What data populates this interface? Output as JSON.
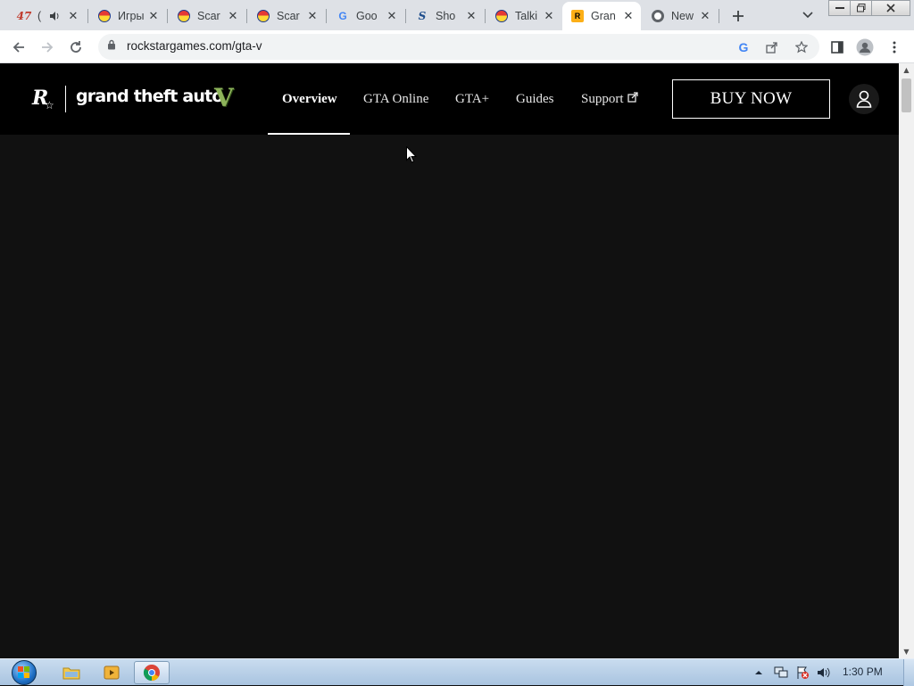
{
  "browser": {
    "tabs": [
      {
        "title": "(",
        "icon": "number-47-icon",
        "has_audio": true,
        "active": false
      },
      {
        "title": "Игры",
        "icon": "multicolor-ball-icon",
        "active": false
      },
      {
        "title": "Scar",
        "icon": "multicolor-ball-icon",
        "active": false
      },
      {
        "title": "Scar",
        "icon": "multicolor-ball-icon",
        "active": false
      },
      {
        "title": "Goo",
        "icon": "google-icon",
        "active": false
      },
      {
        "title": "Sho",
        "icon": "s-logo-icon",
        "active": false
      },
      {
        "title": "Talki",
        "icon": "multicolor-ball-icon",
        "active": false
      },
      {
        "title": "Gran",
        "icon": "rockstar-icon",
        "active": true
      },
      {
        "title": "New",
        "icon": "chrome-icon",
        "active": false
      }
    ],
    "tab0_badge": "47",
    "url": "rockstargames.com/gta-v"
  },
  "site": {
    "logo_text": "grand theft auto",
    "logo_numeral": "V",
    "nav": [
      {
        "label": "Overview",
        "active": true
      },
      {
        "label": "GTA Online",
        "active": false
      },
      {
        "label": "GTA+",
        "active": false
      },
      {
        "label": "Guides",
        "active": false
      },
      {
        "label": "Support",
        "active": false,
        "external": true
      }
    ],
    "buy_label": "BUY NOW"
  },
  "taskbar": {
    "clock": "1:30 PM"
  },
  "colors": {
    "page_bg": "#111111",
    "nav_bg": "#000000",
    "gta_v_green": "#8db35a",
    "chrome_frame": "#dee1e6",
    "taskbar": "#b9d1ea"
  }
}
